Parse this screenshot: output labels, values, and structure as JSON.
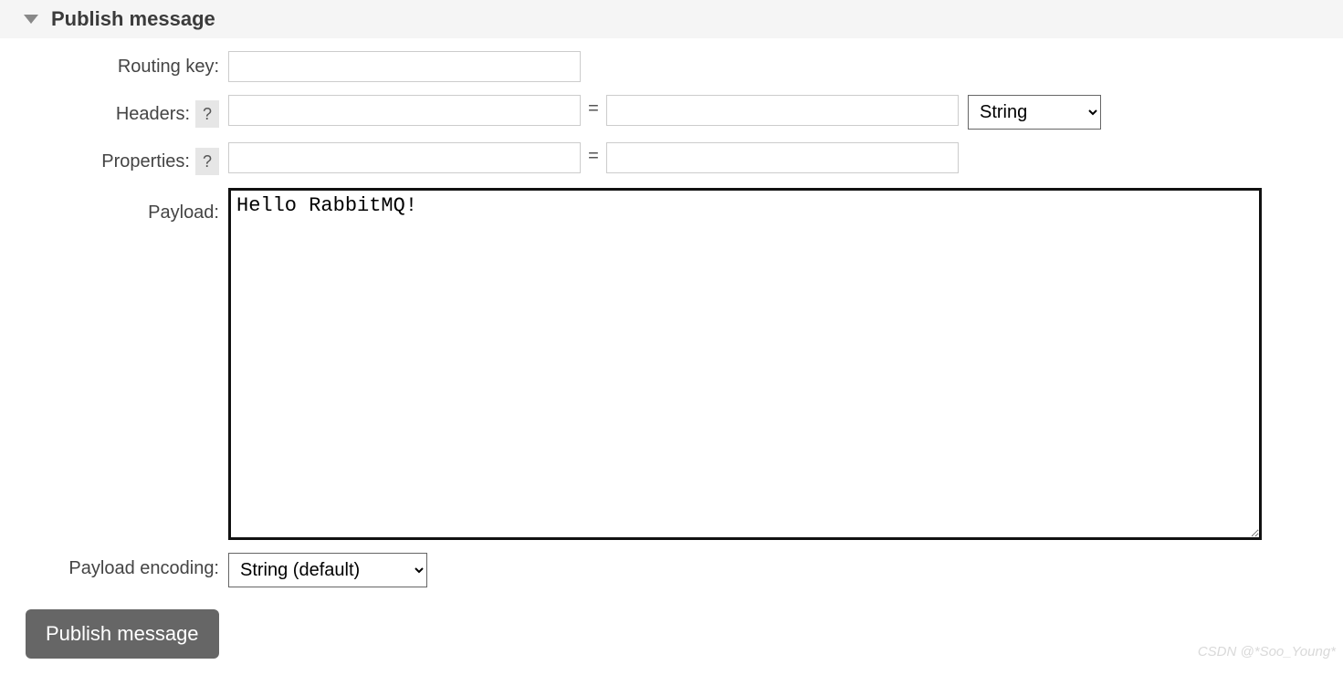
{
  "section": {
    "title": "Publish message"
  },
  "labels": {
    "routing_key": "Routing key:",
    "headers": "Headers:",
    "properties": "Properties:",
    "payload": "Payload:",
    "payload_encoding": "Payload encoding:",
    "help": "?"
  },
  "fields": {
    "routing_key": "",
    "header_key": "",
    "header_value": "",
    "header_type": "String",
    "property_key": "",
    "property_value": "",
    "payload": "Hello RabbitMQ!",
    "payload_encoding": "String (default)",
    "equals": "="
  },
  "buttons": {
    "publish": "Publish message"
  },
  "watermark": "CSDN @*Soo_Young*"
}
